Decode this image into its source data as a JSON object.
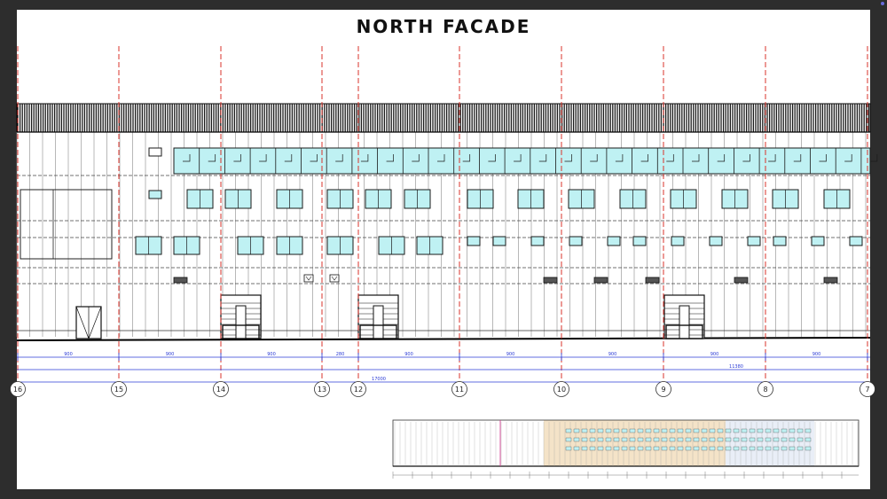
{
  "title": "NORTH FACADE",
  "gridlines": [
    "16",
    "15",
    "14",
    "13",
    "12",
    "11",
    "10",
    "9",
    "8",
    "7"
  ],
  "dimensions": [
    "900",
    "900",
    "900",
    "280",
    "900",
    "900",
    "900",
    "900",
    "900"
  ],
  "overall_dimensions": [
    "11380",
    "17000"
  ],
  "colors": {
    "background": "#2d2d2d",
    "sheet": "#ffffff",
    "grid_line": "#d9332b",
    "dimension_line": "#2b3bd6",
    "glazing": "#bff1f3",
    "roof_band": "#1a1a1a"
  }
}
